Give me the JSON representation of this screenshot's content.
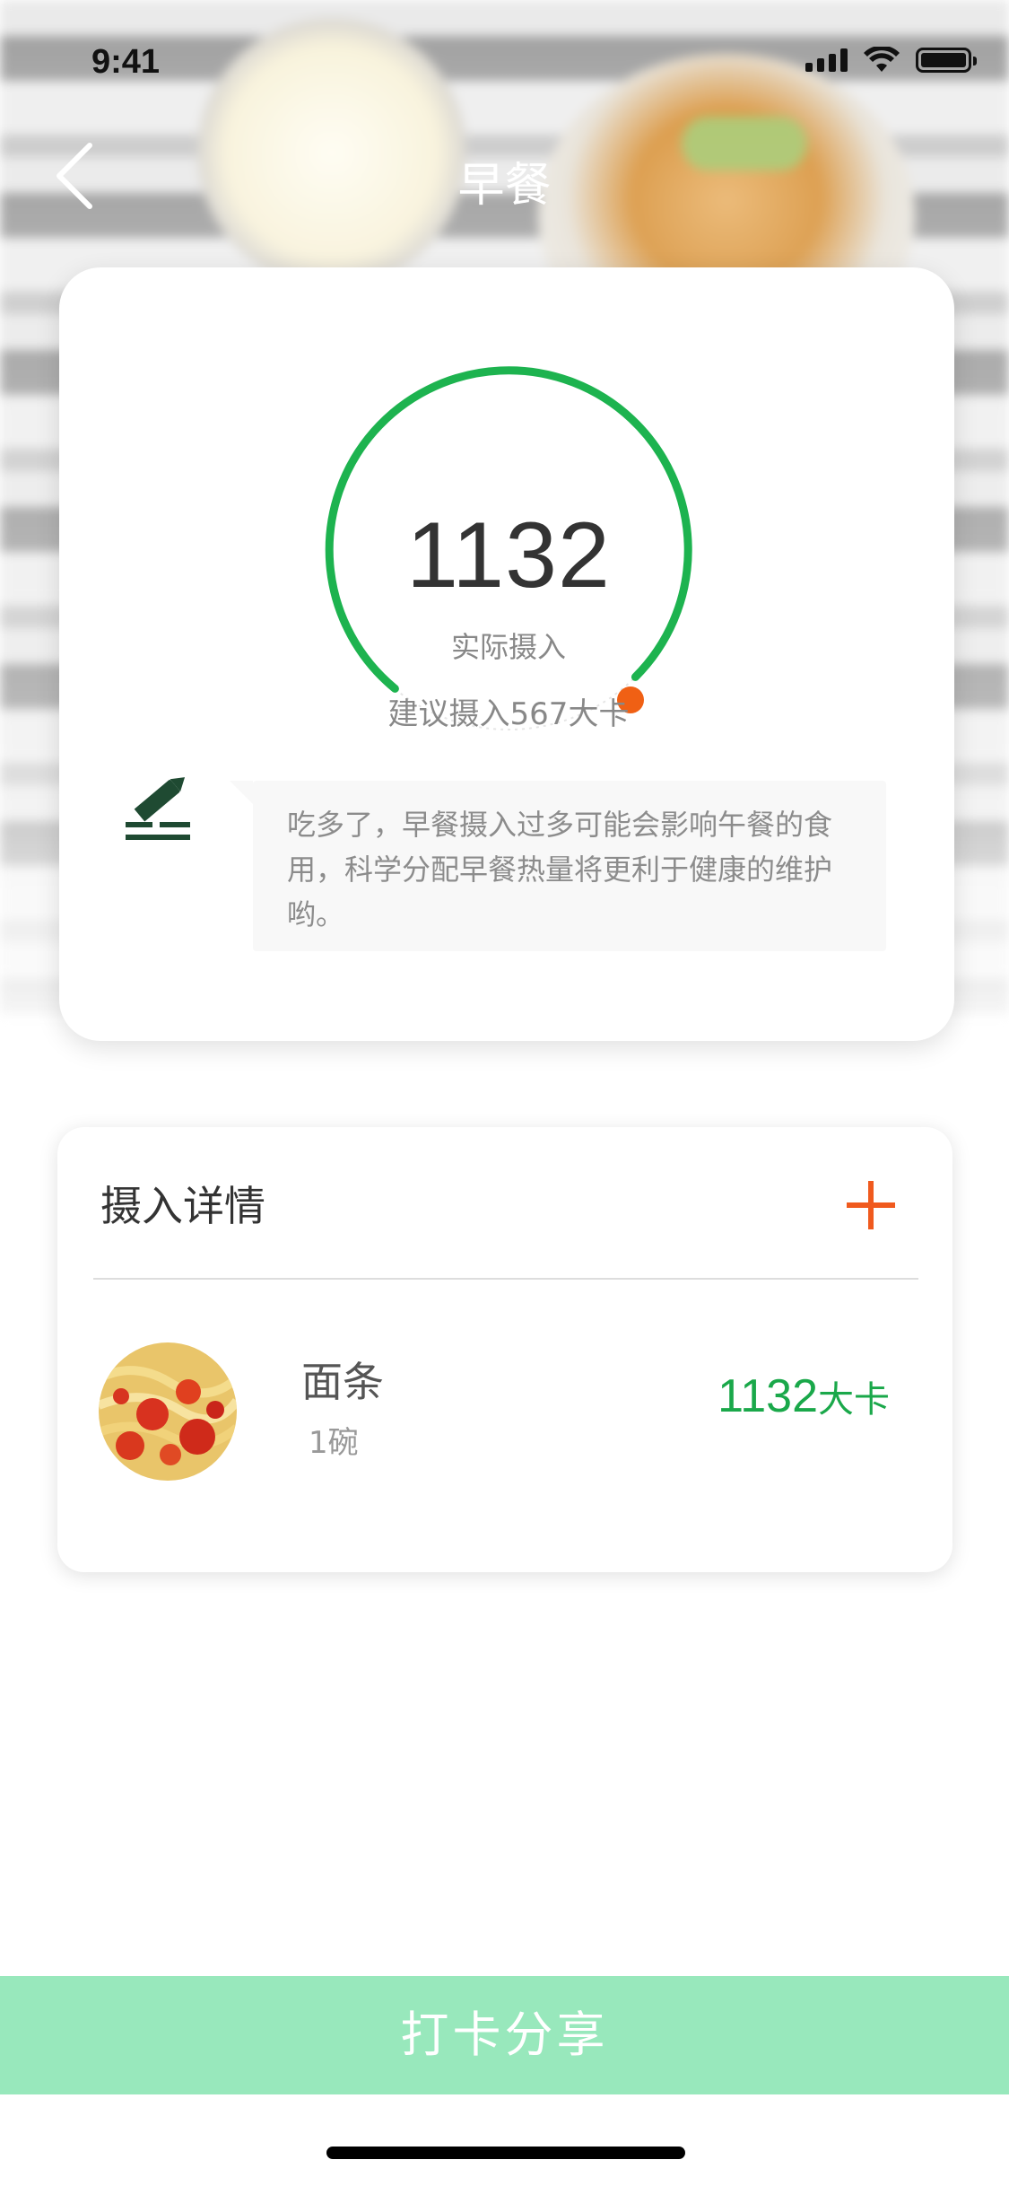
{
  "status_bar": {
    "time": "9:41"
  },
  "nav": {
    "title": "早餐",
    "back_icon": "chevron-left-icon"
  },
  "summary": {
    "actual_kcal": "1132",
    "actual_label": "实际摄入",
    "advice": "建议摄入567大卡",
    "ring_color": "#1db34f",
    "ring_marker_color": "#f06014",
    "tip_icon": "edit-pen-icon",
    "tip": "吃多了，早餐摄入过多可能会影响午餐的食用，科学分配早餐热量将更利于健康的维护哟。"
  },
  "details": {
    "title": "摄入详情",
    "add_icon": "plus-icon",
    "add_color": "#f05a1e",
    "items": [
      {
        "name": "面条",
        "quantity": "1碗",
        "kcal": "1132",
        "unit": "大卡",
        "image_icon": "noodles-photo"
      }
    ]
  },
  "share_button": {
    "label": "打卡分享",
    "color": "#98e8bc"
  }
}
